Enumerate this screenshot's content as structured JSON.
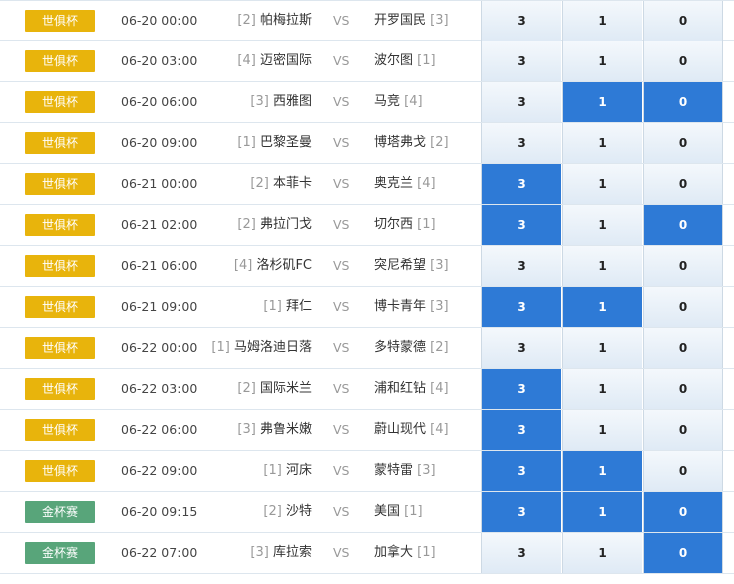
{
  "colors": {
    "world_cup_badge": "#e8b40c",
    "gold_cup_badge": "#58a57a",
    "selected_odds": "#2e7ad6"
  },
  "vs_label": "VS",
  "matches": [
    {
      "league": "世俱杯",
      "type": "wc",
      "time": "06-20 00:00",
      "home_rank": "[2]",
      "home": "帕梅拉斯",
      "away": "开罗国民",
      "away_rank": "[3]",
      "odds": [
        "3",
        "1",
        "0"
      ],
      "selected": [
        false,
        false,
        false
      ]
    },
    {
      "league": "世俱杯",
      "type": "wc",
      "time": "06-20 03:00",
      "home_rank": "[4]",
      "home": "迈密国际",
      "away": "波尔图",
      "away_rank": "[1]",
      "odds": [
        "3",
        "1",
        "0"
      ],
      "selected": [
        false,
        false,
        false
      ]
    },
    {
      "league": "世俱杯",
      "type": "wc",
      "time": "06-20 06:00",
      "home_rank": "[3]",
      "home": "西雅图",
      "away": "马竞",
      "away_rank": "[4]",
      "odds": [
        "3",
        "1",
        "0"
      ],
      "selected": [
        false,
        true,
        true
      ]
    },
    {
      "league": "世俱杯",
      "type": "wc",
      "time": "06-20 09:00",
      "home_rank": "[1]",
      "home": "巴黎圣曼",
      "away": "博塔弗戈",
      "away_rank": "[2]",
      "odds": [
        "3",
        "1",
        "0"
      ],
      "selected": [
        false,
        false,
        false
      ]
    },
    {
      "league": "世俱杯",
      "type": "wc",
      "time": "06-21 00:00",
      "home_rank": "[2]",
      "home": "本菲卡",
      "away": "奥克兰",
      "away_rank": "[4]",
      "odds": [
        "3",
        "1",
        "0"
      ],
      "selected": [
        true,
        false,
        false
      ]
    },
    {
      "league": "世俱杯",
      "type": "wc",
      "time": "06-21 02:00",
      "home_rank": "[2]",
      "home": "弗拉门戈",
      "away": "切尔西",
      "away_rank": "[1]",
      "odds": [
        "3",
        "1",
        "0"
      ],
      "selected": [
        true,
        false,
        true
      ]
    },
    {
      "league": "世俱杯",
      "type": "wc",
      "time": "06-21 06:00",
      "home_rank": "[4]",
      "home": "洛杉矶FC",
      "away": "突尼希望",
      "away_rank": "[3]",
      "odds": [
        "3",
        "1",
        "0"
      ],
      "selected": [
        false,
        false,
        false
      ]
    },
    {
      "league": "世俱杯",
      "type": "wc",
      "time": "06-21 09:00",
      "home_rank": "[1]",
      "home": "拜仁",
      "away": "博卡青年",
      "away_rank": "[3]",
      "odds": [
        "3",
        "1",
        "0"
      ],
      "selected": [
        true,
        true,
        false
      ]
    },
    {
      "league": "世俱杯",
      "type": "wc",
      "time": "06-22 00:00",
      "home_rank": "[1]",
      "home": "马姆洛迪日落",
      "away": "多特蒙德",
      "away_rank": "[2]",
      "odds": [
        "3",
        "1",
        "0"
      ],
      "selected": [
        false,
        false,
        false
      ]
    },
    {
      "league": "世俱杯",
      "type": "wc",
      "time": "06-22 03:00",
      "home_rank": "[2]",
      "home": "国际米兰",
      "away": "浦和红钻",
      "away_rank": "[4]",
      "odds": [
        "3",
        "1",
        "0"
      ],
      "selected": [
        true,
        false,
        false
      ]
    },
    {
      "league": "世俱杯",
      "type": "wc",
      "time": "06-22 06:00",
      "home_rank": "[3]",
      "home": "弗鲁米嫩",
      "away": "蔚山现代",
      "away_rank": "[4]",
      "odds": [
        "3",
        "1",
        "0"
      ],
      "selected": [
        true,
        false,
        false
      ]
    },
    {
      "league": "世俱杯",
      "type": "wc",
      "time": "06-22 09:00",
      "home_rank": "[1]",
      "home": "河床",
      "away": "蒙特雷",
      "away_rank": "[3]",
      "odds": [
        "3",
        "1",
        "0"
      ],
      "selected": [
        true,
        true,
        false
      ]
    },
    {
      "league": "金杯赛",
      "type": "gc",
      "time": "06-20 09:15",
      "home_rank": "[2]",
      "home": "沙特",
      "away": "美国",
      "away_rank": "[1]",
      "odds": [
        "3",
        "1",
        "0"
      ],
      "selected": [
        true,
        true,
        true
      ]
    },
    {
      "league": "金杯赛",
      "type": "gc",
      "time": "06-22 07:00",
      "home_rank": "[3]",
      "home": "库拉索",
      "away": "加拿大",
      "away_rank": "[1]",
      "odds": [
        "3",
        "1",
        "0"
      ],
      "selected": [
        false,
        false,
        true
      ]
    }
  ]
}
